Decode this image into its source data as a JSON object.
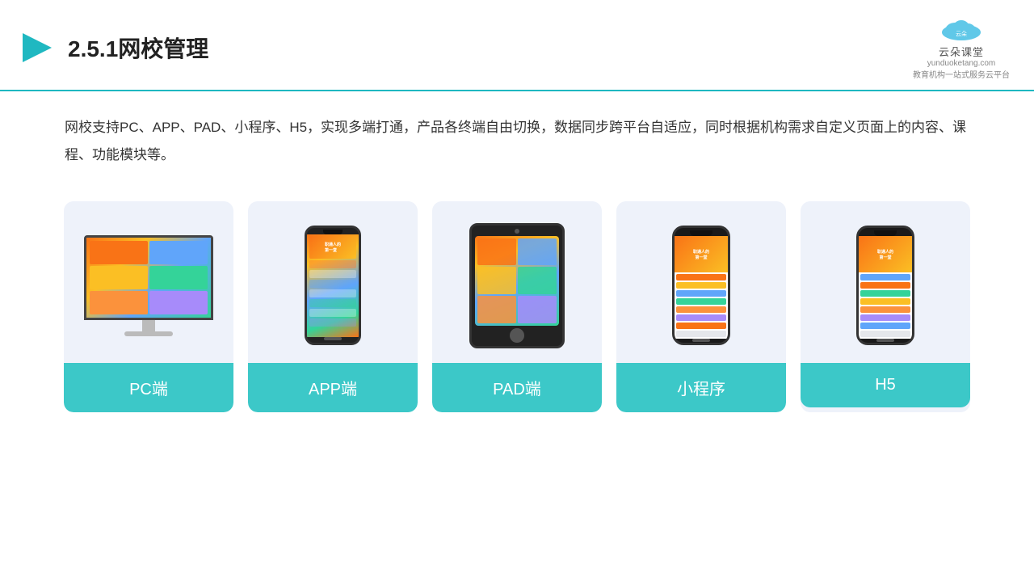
{
  "header": {
    "title": "2.5.1网校管理",
    "brand": {
      "name": "云朵课堂",
      "domain": "yunduoketang.com",
      "sub": "教育机构一站式服务云平台"
    }
  },
  "description": "网校支持PC、APP、PAD、小程序、H5，实现多端打通，产品各终端自由切换，数据同步跨平台自适应，同时根据机构需求自定义页面上的内容、课程、功能模块等。",
  "cards": [
    {
      "id": "pc",
      "label": "PC端"
    },
    {
      "id": "app",
      "label": "APP端"
    },
    {
      "id": "pad",
      "label": "PAD端"
    },
    {
      "id": "miniapp",
      "label": "小程序"
    },
    {
      "id": "h5",
      "label": "H5"
    }
  ],
  "colors": {
    "accent": "#3cc8c8",
    "header_line": "#1fb8c1",
    "card_bg": "#eef2f9",
    "text_main": "#333333"
  }
}
